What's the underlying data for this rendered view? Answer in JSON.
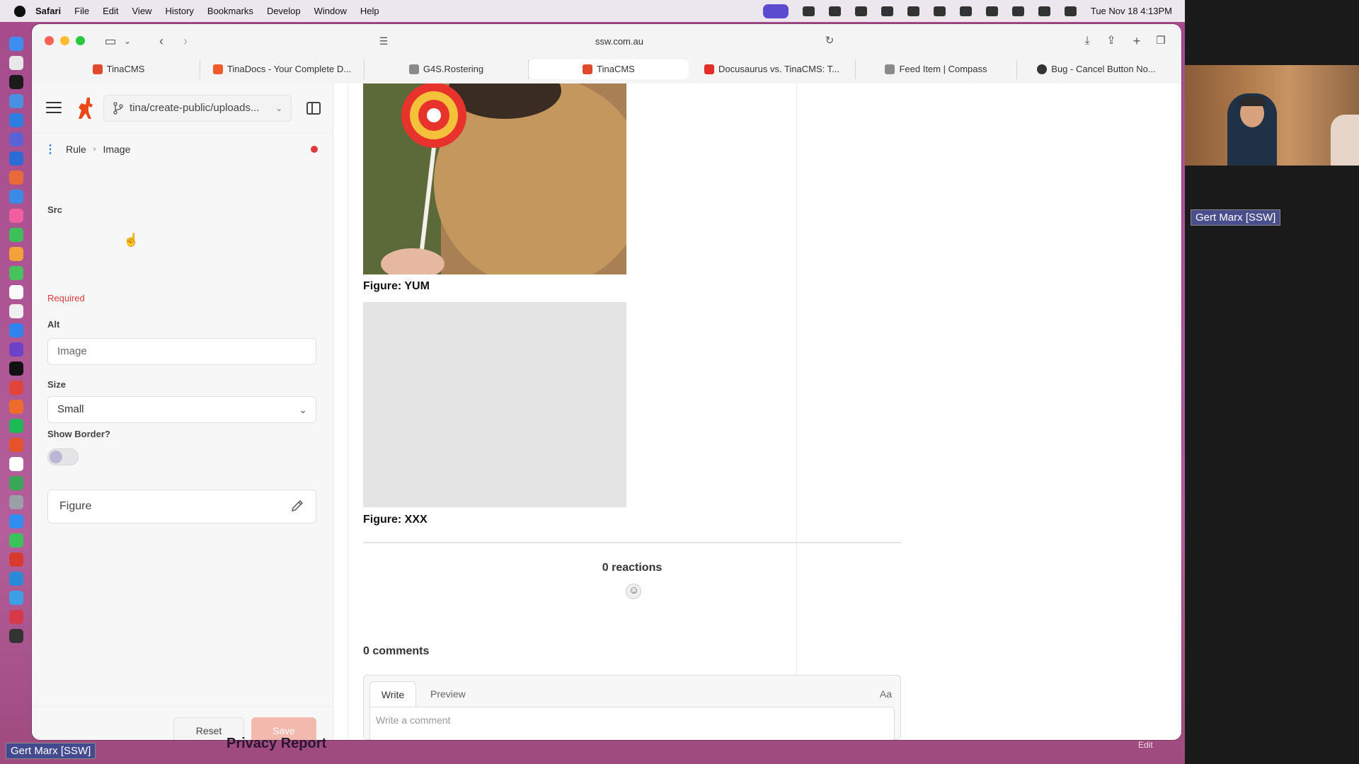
{
  "menubar": {
    "app": "Safari",
    "items": [
      "File",
      "Edit",
      "View",
      "History",
      "Bookmarks",
      "Develop",
      "Window",
      "Help"
    ],
    "clock": "Tue Nov 18  4:13PM"
  },
  "browser": {
    "address": "ssw.com.au",
    "tabs": [
      {
        "label": "TinaCMS",
        "color": "#e04a2a"
      },
      {
        "label": "TinaDocs - Your Complete D...",
        "color": "#f25a2c"
      },
      {
        "label": "G4S.Rostering",
        "color": "#8a8a8a"
      },
      {
        "label": "TinaCMS",
        "color": "#e04a2a"
      },
      {
        "label": "Docusaurus vs. TinaCMS: T...",
        "color": "#e52d27"
      },
      {
        "label": "Feed Item | Compass",
        "color": "#8a8a8a"
      },
      {
        "label": "Bug - Cancel Button No...",
        "color": "#333333"
      }
    ]
  },
  "sidebar": {
    "branch": "tina/create-public/uploads...",
    "breadcrumb": {
      "parent": "Rule",
      "current": "Image"
    },
    "src_label": "Src",
    "required": "Required",
    "alt_label": "Alt",
    "alt_placeholder": "Image",
    "size_label": "Size",
    "size_value": "Small",
    "border_label": "Show Border?",
    "border_on": false,
    "figure_label": "Figure",
    "reset": "Reset",
    "save": "Save"
  },
  "preview": {
    "caption_1": "Figure: YUM",
    "caption_2": "Figure: XXX",
    "reactions": "0 reactions",
    "comments": "0 comments",
    "tab_write": "Write",
    "tab_preview": "Preview",
    "aa": "Aa",
    "comment_placeholder": "Write a comment"
  },
  "desktop": {
    "privacy_report": "Privacy Report",
    "edit": "Edit",
    "participant": "Gert Marx [SSW]"
  },
  "colors": {
    "accent": "#1f7ae0",
    "required": "#e03a3a",
    "save_disabled": "#f4b9ad",
    "tina_brand": "#ec4815"
  }
}
